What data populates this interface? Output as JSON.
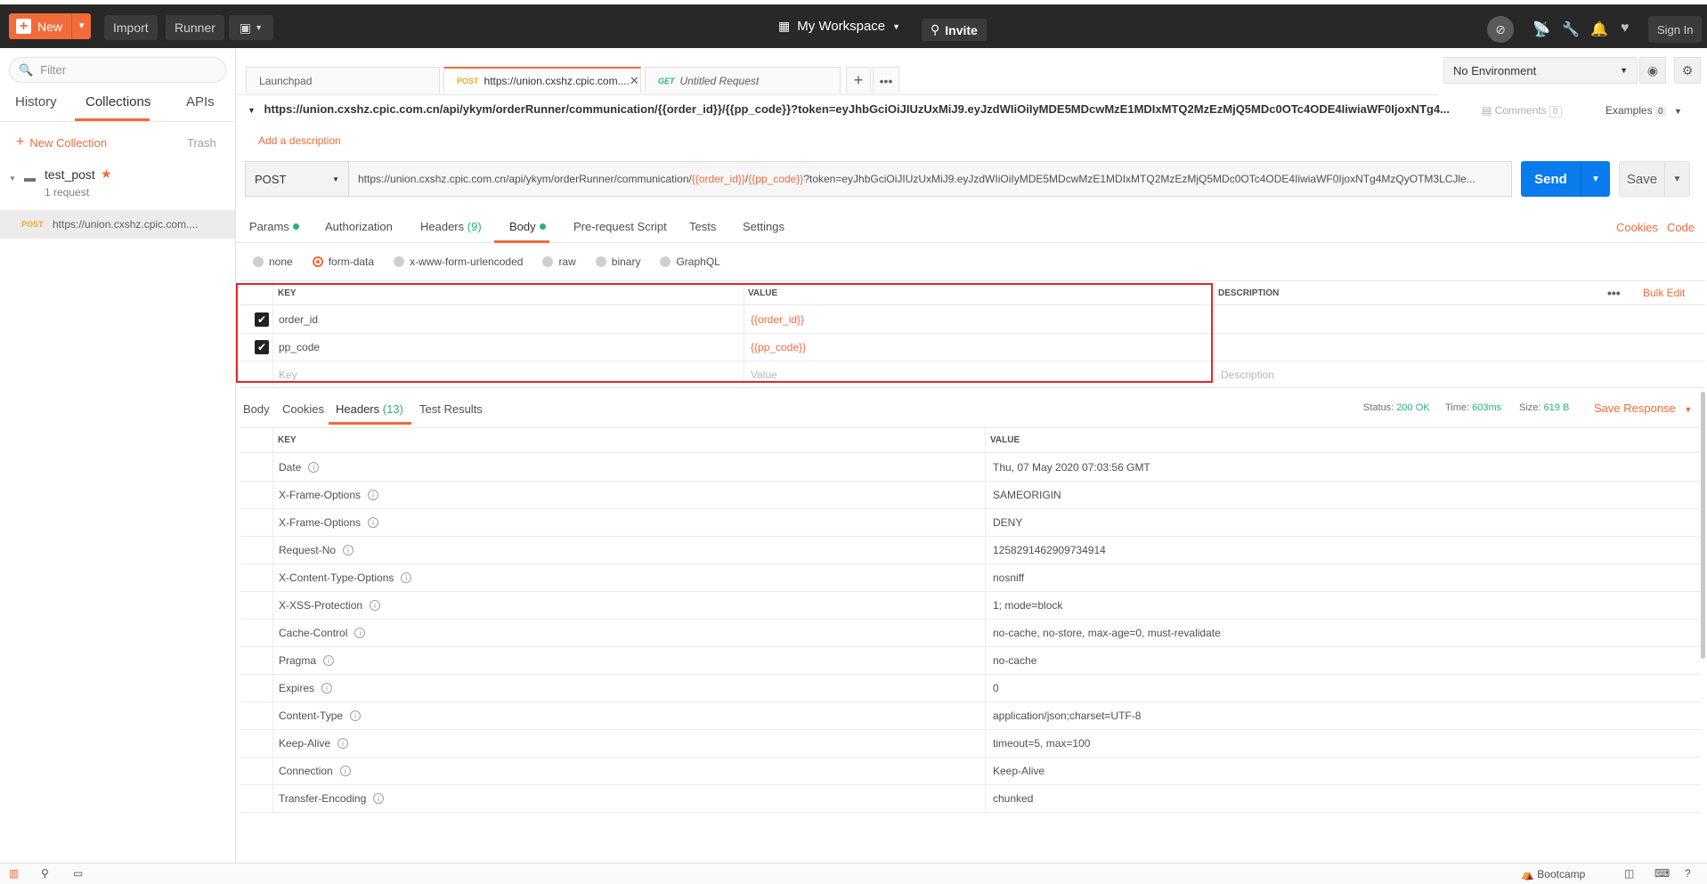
{
  "topbar": {
    "new_label": "New",
    "import_label": "Import",
    "runner_label": "Runner",
    "workspace_label": "My Workspace",
    "invite_label": "Invite",
    "signin_label": "Sign In"
  },
  "sidebar": {
    "filter_placeholder": "Filter",
    "tabs": [
      "History",
      "Collections",
      "APIs"
    ],
    "new_collection_label": "New Collection",
    "trash_label": "Trash",
    "collection": {
      "name": "test_post",
      "count": "1 request"
    },
    "request": {
      "method": "POST",
      "url": "https://union.cxshz.cpic.com...."
    }
  },
  "tabs": [
    {
      "label": "Launchpad"
    },
    {
      "method": "POST",
      "label": "https://union.cxshz.cpic.com...."
    },
    {
      "method": "GET",
      "label": "Untitled Request"
    }
  ],
  "environment": {
    "selected": "No Environment"
  },
  "request": {
    "title": "https://union.cxshz.cpic.com.cn/api/ykym/orderRunner/communication/{{order_id}}/{{pp_code}}?token=eyJhbGciOiJIUzUxMiJ9.eyJzdWIiOiIyMDE5MDcwMzE1MDIxMTQ2MzEzMjQ5MDc0OTc4ODE4IiwiaWF0IjoxNTg4...",
    "comments_label": "Comments",
    "comments_count": "0",
    "examples_label": "Examples",
    "examples_count": "0",
    "add_description": "Add a description",
    "method": "POST",
    "url_prefix": "https://union.cxshz.cpic.com.cn/api/ykym/orderRunner/communication/",
    "url_var1": "{{order_id}}",
    "url_sep": "/",
    "url_var2": "{{pp_code}}",
    "url_suffix": "?token=eyJhbGciOiJIUzUxMiJ9.eyJzdWIiOiIyMDE5MDcwMzE1MDIxMTQ2MzEzMjQ5MDc0OTc4ODE4IiwiaWF0IjoxNTg4MzQyOTM3LCJle...",
    "send_label": "Send",
    "save_label": "Save"
  },
  "subtabs": {
    "params": "Params",
    "authorization": "Authorization",
    "headers": "Headers",
    "headers_count": "(9)",
    "body": "Body",
    "prerequest": "Pre-request Script",
    "tests": "Tests",
    "settings": "Settings",
    "cookies": "Cookies",
    "code": "Code"
  },
  "body_modes": [
    "none",
    "form-data",
    "x-www-form-urlencoded",
    "raw",
    "binary",
    "GraphQL"
  ],
  "form_table": {
    "headers": {
      "key": "KEY",
      "value": "VALUE",
      "description": "DESCRIPTION",
      "bulk_edit": "Bulk Edit"
    },
    "rows": [
      {
        "key": "order_id",
        "value": "{{order_id}}"
      },
      {
        "key": "pp_code",
        "value": "{{pp_code}}"
      }
    ],
    "placeholder": {
      "key": "Key",
      "value": "Value",
      "description": "Description"
    }
  },
  "response": {
    "tabs": {
      "body": "Body",
      "cookies": "Cookies",
      "headers": "Headers",
      "headers_count": "(13)",
      "test_results": "Test Results"
    },
    "status_label": "Status:",
    "status_value": "200 OK",
    "time_label": "Time:",
    "time_value": "603ms",
    "size_label": "Size:",
    "size_value": "619 B",
    "save_response": "Save Response",
    "headers_table": {
      "key_label": "KEY",
      "value_label": "VALUE",
      "rows": [
        {
          "key": "Date",
          "value": "Thu, 07 May 2020 07:03:56 GMT"
        },
        {
          "key": "X-Frame-Options",
          "value": "SAMEORIGIN"
        },
        {
          "key": "X-Frame-Options",
          "value": "DENY"
        },
        {
          "key": "Request-No",
          "value": "1258291462909734914"
        },
        {
          "key": "X-Content-Type-Options",
          "value": "nosniff"
        },
        {
          "key": "X-XSS-Protection",
          "value": "1; mode=block"
        },
        {
          "key": "Cache-Control",
          "value": "no-cache, no-store, max-age=0, must-revalidate"
        },
        {
          "key": "Pragma",
          "value": "no-cache"
        },
        {
          "key": "Expires",
          "value": "0"
        },
        {
          "key": "Content-Type",
          "value": "application/json;charset=UTF-8"
        },
        {
          "key": "Keep-Alive",
          "value": "timeout=5, max=100"
        },
        {
          "key": "Connection",
          "value": "Keep-Alive"
        },
        {
          "key": "Transfer-Encoding",
          "value": "chunked"
        }
      ]
    }
  },
  "statusbar": {
    "bootcamp_label": "Bootcamp"
  },
  "colors": {
    "accent": "#f26b3a",
    "send": "#097bed",
    "success": "#26b47f",
    "highlight_box": "#e3252c"
  }
}
